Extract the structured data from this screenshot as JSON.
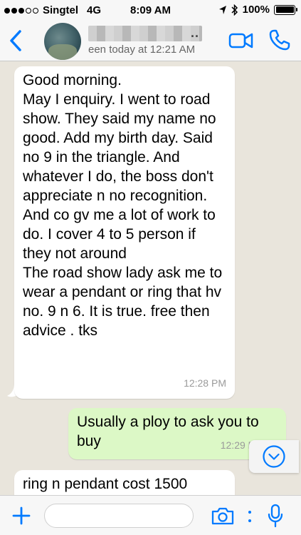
{
  "status_bar": {
    "carrier": "Singtel",
    "network": "4G",
    "time": "8:09 AM",
    "battery": "100%",
    "battery_level": 1.0
  },
  "header": {
    "last_seen": "een today at 12:21 AM",
    "name_suffix": ".."
  },
  "messages": [
    {
      "direction": "incoming",
      "text": "Good morning.\nMay I enquiry. I went to road show. They said my name no good. Add my birth day. Said no 9 in the triangle. And whatever I do, the boss don't appreciate n no recognition. And co gv me a lot of work to do. I cover 4 to 5 person if they not around\nThe road show lady ask me to wear a pendant or ring that hv no. 9 n 6. It is true. free then advice . tks",
      "time": "12:28 PM"
    },
    {
      "direction": "outgoing",
      "text": "Usually a ploy to ask you to buy",
      "time": "12:29 P"
    },
    {
      "direction": "incoming",
      "text": "ring n pendant cost 1500"
    }
  ],
  "colors": {
    "accent": "#007aff",
    "chat_background": "#e9e5dc",
    "outgoing_bubble": "#dcf8c6",
    "incoming_bubble": "#ffffff"
  },
  "icons": {
    "back": "chevron-left-icon",
    "video": "video-camera-icon",
    "call": "phone-icon",
    "plus": "plus-icon",
    "camera": "camera-icon",
    "mic": "microphone-icon",
    "scroll": "chevron-down-circle-icon"
  }
}
